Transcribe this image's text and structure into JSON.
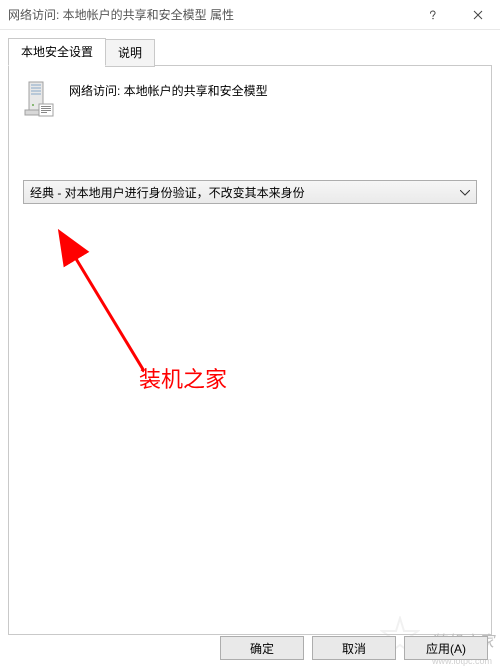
{
  "window": {
    "title": "网络访问: 本地帐户的共享和安全模型 属性"
  },
  "tabs": {
    "active": "本地安全设置",
    "inactive": "说明"
  },
  "content": {
    "heading": "网络访问: 本地帐户的共享和安全模型",
    "dropdown_value": "经典 - 对本地用户进行身份验证，不改变其本来身份"
  },
  "annotation": {
    "text": "装机之家"
  },
  "watermark": {
    "main": "装机之家",
    "sub": "www.lotpc.com"
  },
  "buttons": {
    "ok": "确定",
    "cancel": "取消",
    "apply": "应用(A)"
  }
}
